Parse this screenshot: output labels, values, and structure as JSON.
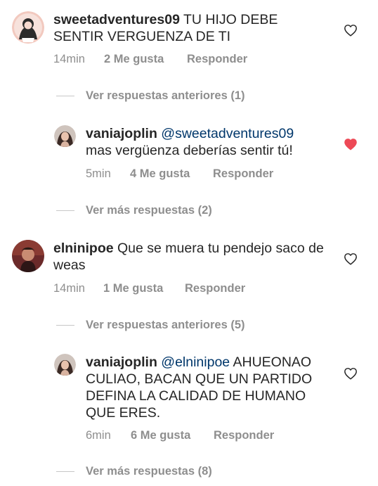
{
  "comments": [
    {
      "username": "sweetadventures09",
      "text": " TU HIJO DEBE SENTIR VERGUENZA DE TI",
      "time": "14min",
      "likes": "2 Me gusta",
      "reply": "Responder",
      "liked": false,
      "avatar_icon": "avatar-illustration-icon"
    },
    {
      "username": "vaniajoplin",
      "mention": "@sweetadventures09",
      "text": "mas vergüenza deberías sentir tú!",
      "time": "5min",
      "likes": "4 Me gusta",
      "reply": "Responder",
      "liked": true,
      "avatar_icon": "avatar-photo-icon"
    },
    {
      "username": "elninipoe",
      "text": " Que se muera tu pendejo saco de weas",
      "time": "14min",
      "likes": "1 Me gusta",
      "reply": "Responder",
      "liked": false,
      "avatar_icon": "avatar-photo-icon"
    },
    {
      "username": "vaniajoplin",
      "mention": "@elninipoe",
      "text": " AHUEONAO CULIAO, BACAN QUE UN PARTIDO DEFINA LA CALIDAD DE HUMANO QUE ERES.",
      "time": "6min",
      "likes": "6 Me gusta",
      "reply": "Responder",
      "liked": false,
      "avatar_icon": "avatar-photo-icon"
    }
  ],
  "view_replies": [
    "Ver respuestas anteriores (1)",
    "Ver más respuestas (2)",
    "Ver respuestas anteriores (5)",
    "Ver más respuestas (8)"
  ],
  "colors": {
    "text": "#262626",
    "secondary": "#8e8e8e",
    "mention": "#00376b",
    "liked_heart": "#ed4956"
  },
  "icons": {
    "like": "heart-outline-icon",
    "liked": "heart-filled-icon"
  }
}
